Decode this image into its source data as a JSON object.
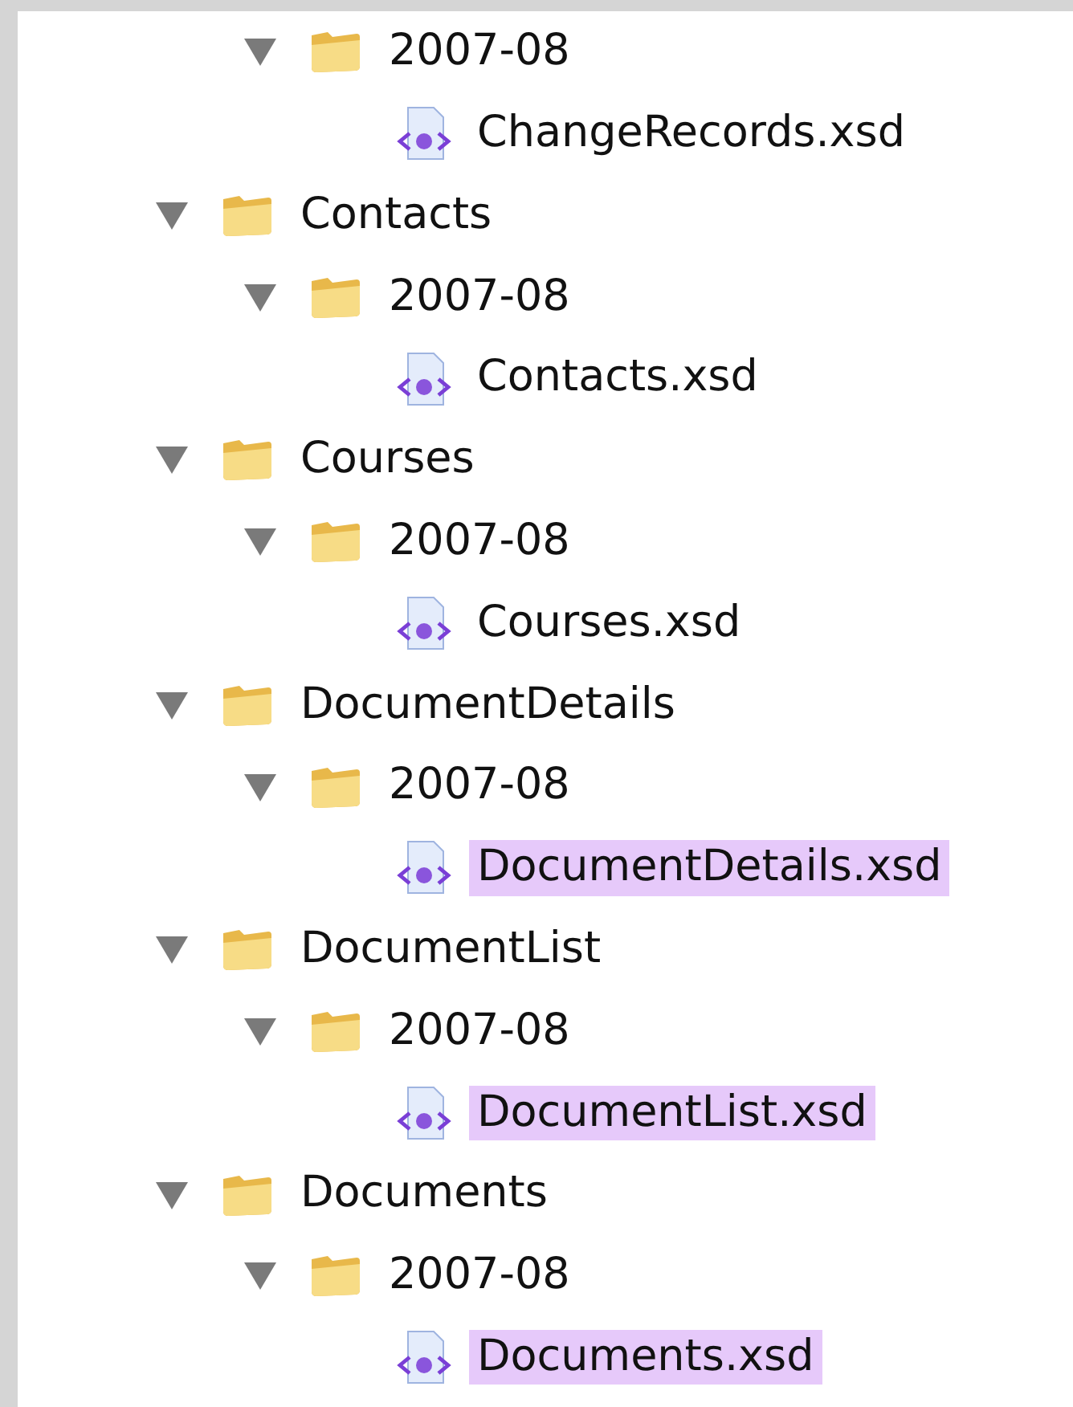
{
  "top_branch": [
    {
      "kind": "folder",
      "label": "2007-08",
      "expanded": true,
      "children": [
        {
          "kind": "file",
          "label": "ChangeRecords.xsd",
          "highlighted": false
        }
      ]
    }
  ],
  "tree": [
    {
      "kind": "folder",
      "label": "Contacts",
      "expanded": true,
      "children": [
        {
          "kind": "folder",
          "label": "2007-08",
          "expanded": true,
          "children": [
            {
              "kind": "file",
              "label": "Contacts.xsd",
              "highlighted": false
            }
          ]
        }
      ]
    },
    {
      "kind": "folder",
      "label": "Courses",
      "expanded": true,
      "children": [
        {
          "kind": "folder",
          "label": "2007-08",
          "expanded": true,
          "children": [
            {
              "kind": "file",
              "label": "Courses.xsd",
              "highlighted": false
            }
          ]
        }
      ]
    },
    {
      "kind": "folder",
      "label": "DocumentDetails",
      "expanded": true,
      "children": [
        {
          "kind": "folder",
          "label": "2007-08",
          "expanded": true,
          "children": [
            {
              "kind": "file",
              "label": "DocumentDetails.xsd",
              "highlighted": true
            }
          ]
        }
      ]
    },
    {
      "kind": "folder",
      "label": "DocumentList",
      "expanded": true,
      "children": [
        {
          "kind": "folder",
          "label": "2007-08",
          "expanded": true,
          "children": [
            {
              "kind": "file",
              "label": "DocumentList.xsd",
              "highlighted": true
            }
          ]
        }
      ]
    },
    {
      "kind": "folder",
      "label": "Documents",
      "expanded": true,
      "children": [
        {
          "kind": "folder",
          "label": "2007-08",
          "expanded": true,
          "children": [
            {
              "kind": "file",
              "label": "Documents.xsd",
              "highlighted": true
            }
          ]
        }
      ]
    }
  ]
}
